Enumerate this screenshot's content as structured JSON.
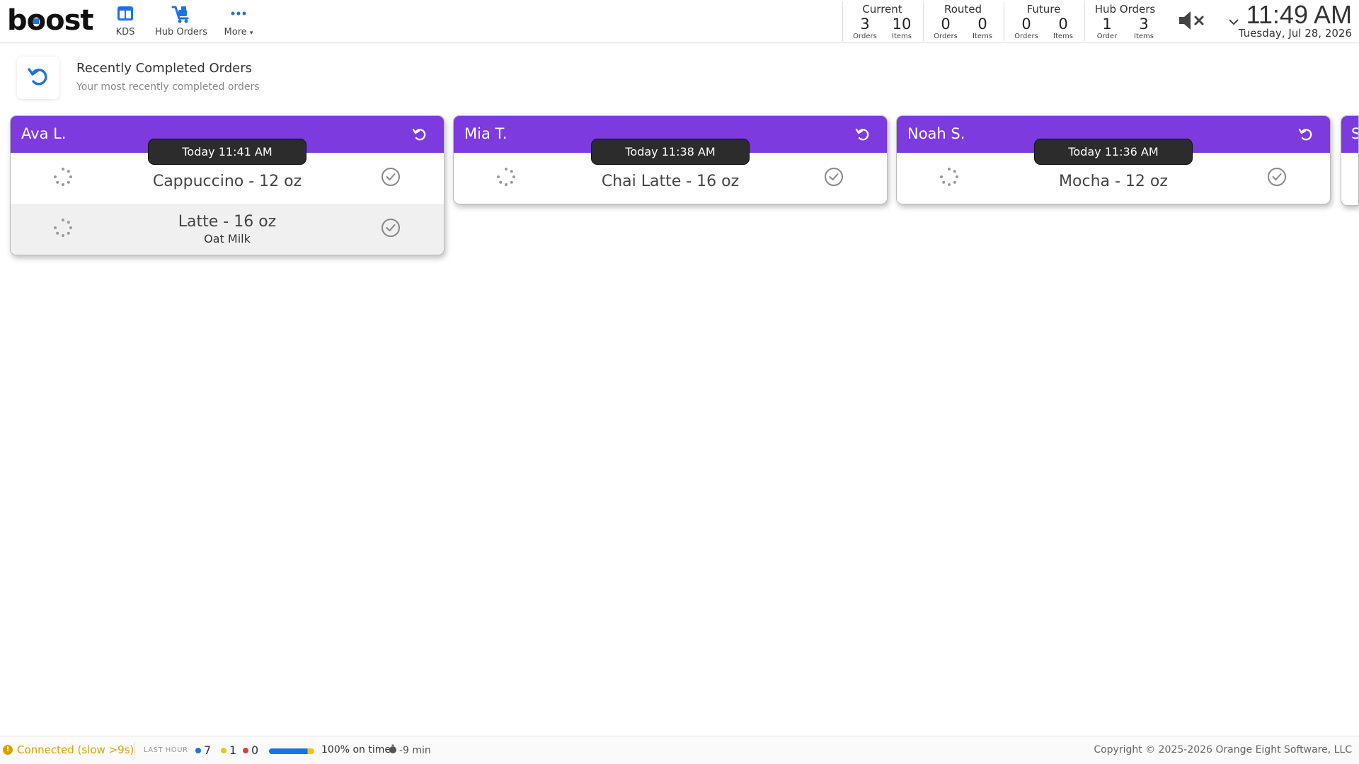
{
  "brand": {
    "logo_text": "boost"
  },
  "nav": [
    {
      "label": "KDS",
      "icon": "kds-columns-icon"
    },
    {
      "label": "Hub Orders",
      "icon": "hub-cart-icon"
    },
    {
      "label": "More",
      "icon": "more-dots-icon"
    }
  ],
  "stats": {
    "current": {
      "title": "Current",
      "orders": "3",
      "orders_label": "Orders",
      "items": "10",
      "items_label": "Items"
    },
    "routed": {
      "title": "Routed",
      "orders": "0",
      "orders_label": "Orders",
      "items": "0",
      "items_label": "Items"
    },
    "future": {
      "title": "Future",
      "orders": "0",
      "orders_label": "Orders",
      "items": "0",
      "items_label": "Items"
    },
    "hub": {
      "title": "Hub Orders",
      "orders": "1",
      "orders_label": "Order",
      "items": "3",
      "items_label": "Items"
    }
  },
  "clock": {
    "time": "11:49 AM",
    "date": "Tuesday, Jul 28, 2026"
  },
  "page": {
    "title": "Recently Completed Orders",
    "subtitle": "Your most recently completed orders"
  },
  "cards": [
    {
      "name": "Ava L.",
      "time": "Today 11:41 AM",
      "items": [
        {
          "name": "Cappuccino - 12 oz",
          "modifier": ""
        },
        {
          "name": "Latte - 16 oz",
          "modifier": "Oat Milk"
        }
      ]
    },
    {
      "name": "Mia T.",
      "time": "Today 11:38 AM",
      "items": [
        {
          "name": "Chai Latte - 16 oz",
          "modifier": ""
        }
      ]
    },
    {
      "name": "Noah S.",
      "time": "Today 11:36 AM",
      "items": [
        {
          "name": "Mocha - 12 oz",
          "modifier": ""
        }
      ]
    }
  ],
  "peek_card": {
    "name": "S"
  },
  "footer": {
    "connection": "Connected (slow >9s)",
    "last_hour_label": "LAST HOUR",
    "count_blue": "7",
    "count_yellow": "1",
    "count_red": "0",
    "on_time_fraction": 1.0,
    "on_time_text": "100% on time",
    "avg_text": "-9 min",
    "copyright": "Copyright © 2025-2026 Orange Eight Software, LLC"
  },
  "colors": {
    "accent": "#1a73e8",
    "card_header": "#7c3adf",
    "warning": "#d9a300",
    "dot_blue": "#1a73e8",
    "dot_yellow": "#f5c400",
    "dot_red": "#e53935"
  }
}
